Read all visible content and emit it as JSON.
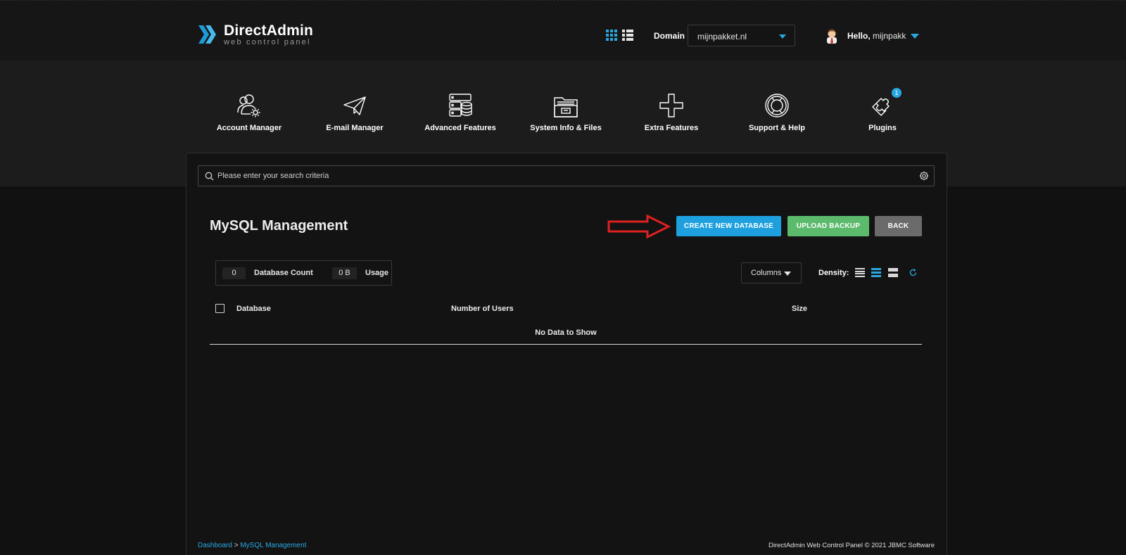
{
  "header": {
    "logo_name": "DirectAdmin",
    "logo_sub": "web control panel",
    "domain_label": "Domain",
    "domain_value": "mijnpakket.nl",
    "hello_prefix": "Hello,",
    "username": "mijnpakk"
  },
  "nav": [
    {
      "label": "Account Manager",
      "icon": "account-manager-icon"
    },
    {
      "label": "E-mail Manager",
      "icon": "paper-plane-icon"
    },
    {
      "label": "Advanced Features",
      "icon": "server-database-icon"
    },
    {
      "label": "System Info & Files",
      "icon": "folder-icon"
    },
    {
      "label": "Extra Features",
      "icon": "plus-icon"
    },
    {
      "label": "Support & Help",
      "icon": "lifebuoy-icon"
    },
    {
      "label": "Plugins",
      "icon": "puzzle-icon",
      "badge": "1"
    }
  ],
  "search": {
    "placeholder": "Please enter your search criteria"
  },
  "page": {
    "title": "MySQL Management",
    "buttons": {
      "create": "CREATE NEW DATABASE",
      "upload": "UPLOAD BACKUP",
      "back": "BACK"
    }
  },
  "stats": {
    "count_value": "0",
    "count_label": "Database Count",
    "usage_value": "0 B",
    "usage_label": "Usage"
  },
  "table": {
    "columns_button": "Columns",
    "density_label": "Density:",
    "headers": [
      "Database",
      "Number of Users",
      "Size"
    ],
    "empty_text": "No Data to Show"
  },
  "footer": {
    "breadcrumb_home": "Dashboard",
    "breadcrumb_sep": " > ",
    "breadcrumb_current": "MySQL Management",
    "copyright": "DirectAdmin Web Control Panel © 2021 JBMC Software"
  },
  "colors": {
    "accent": "#1ea0df",
    "success": "#5cba6c",
    "neutral": "#6b6b6b",
    "annotation_arrow": "#e02020"
  }
}
